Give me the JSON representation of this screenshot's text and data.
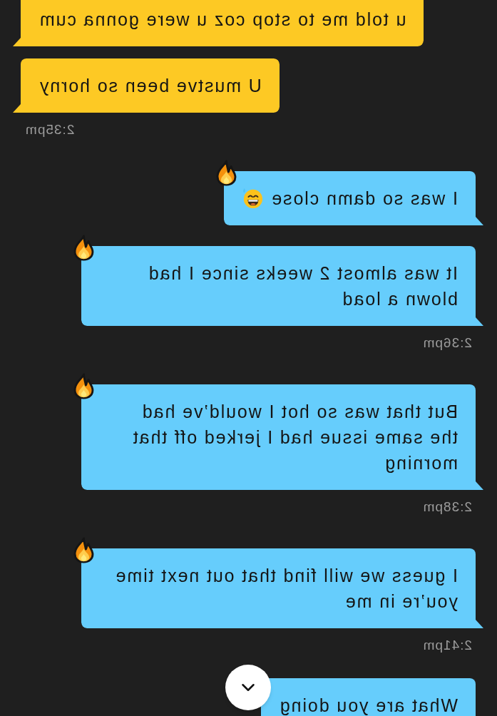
{
  "chat": {
    "items": [
      {
        "kind": "message",
        "outgoing": false,
        "text": "u told me to stop coz u were gonna cum",
        "reacted": false,
        "trailing_emoji": false
      },
      {
        "kind": "message",
        "outgoing": false,
        "text": "U mustve been so horny",
        "reacted": false,
        "trailing_emoji": false
      },
      {
        "kind": "timestamp",
        "outgoing": false,
        "text": "2:35pm"
      },
      {
        "kind": "message",
        "outgoing": true,
        "text": "I was so damn close",
        "reacted": true,
        "trailing_emoji": true
      },
      {
        "kind": "message",
        "outgoing": true,
        "text": "It was almost 2 weeks since I had\nblown a load",
        "reacted": true,
        "trailing_emoji": false
      },
      {
        "kind": "timestamp",
        "outgoing": true,
        "text": "2:36pm"
      },
      {
        "kind": "message",
        "outgoing": true,
        "text": "But that was so hot I would’ve had\nthe same issue had I jerked off that\nmorning",
        "reacted": true,
        "trailing_emoji": false
      },
      {
        "kind": "timestamp",
        "outgoing": true,
        "text": "2:38pm"
      },
      {
        "kind": "message",
        "outgoing": true,
        "text": "I guess we will find that out next time\nyou’re in me",
        "reacted": true,
        "trailing_emoji": false
      },
      {
        "kind": "timestamp",
        "outgoing": true,
        "text": "2:41pm"
      },
      {
        "kind": "message",
        "outgoing": true,
        "text": "What are you doing",
        "reacted": false,
        "trailing_emoji": false
      }
    ]
  }
}
